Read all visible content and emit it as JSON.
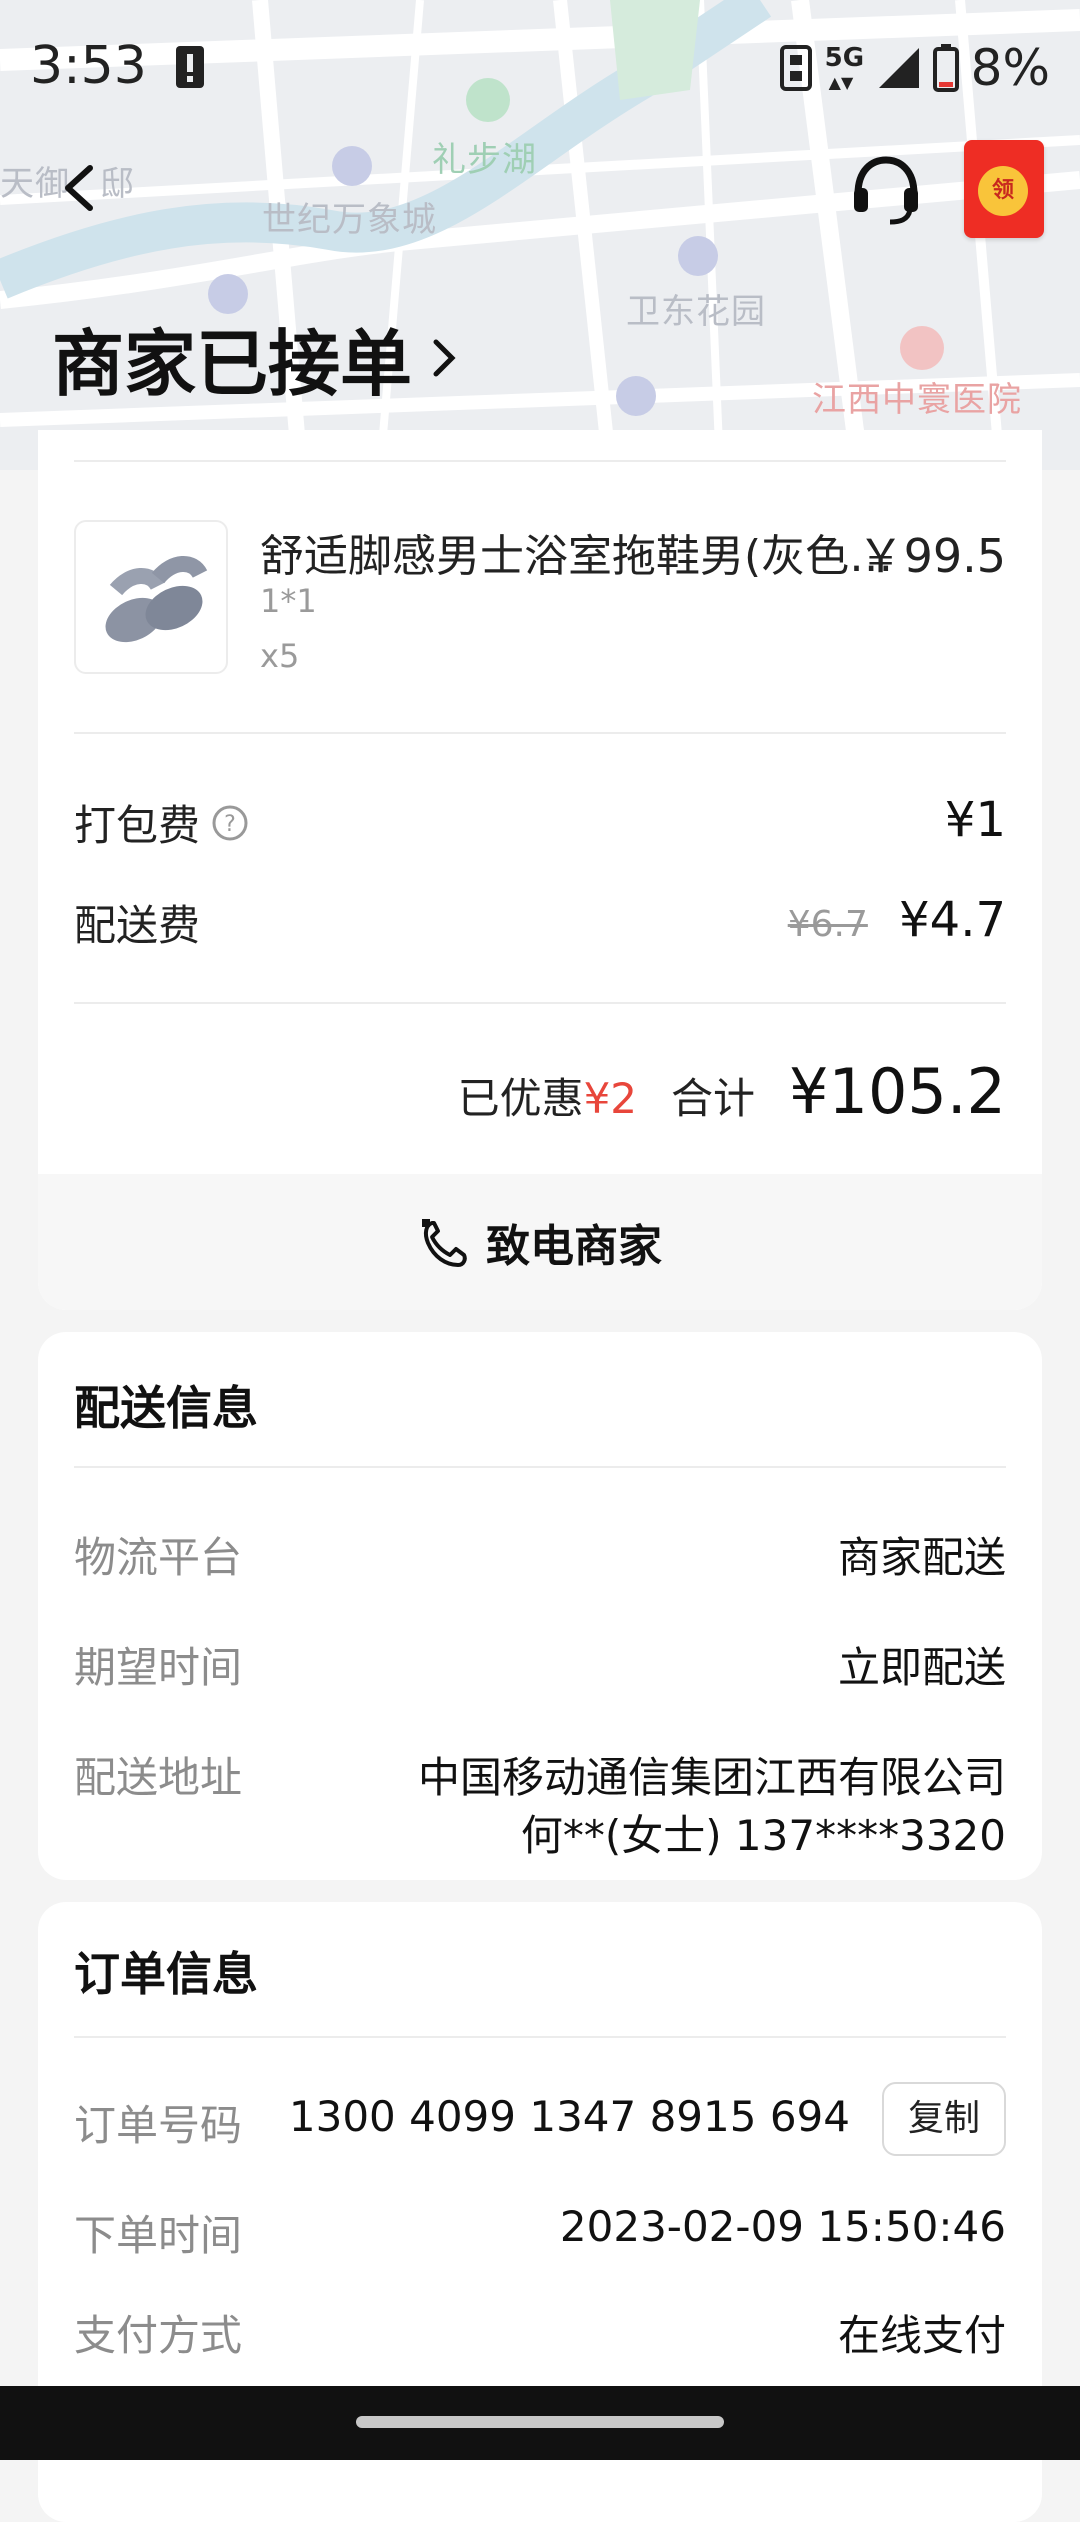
{
  "status_bar": {
    "time": "3:53",
    "network": "5G",
    "battery": "8%"
  },
  "map": {
    "labels": [
      "礼步湖",
      "天御",
      "邸",
      "世纪万象城",
      "卫东花园",
      "江西中寰医院"
    ]
  },
  "header": {
    "title": "商家已接单",
    "redpacket_label": "领"
  },
  "order": {
    "product": {
      "name": "舒适脚感男士浴室拖鞋男(灰色…",
      "price": "￥99.5",
      "spec": "1*1",
      "quantity": "x5"
    },
    "packing_fee": {
      "label": "打包费",
      "value": "¥1"
    },
    "delivery_fee": {
      "label": "配送费",
      "original": "¥6.7",
      "value": "¥4.7"
    },
    "discount": {
      "label": "已优惠",
      "value": "¥2"
    },
    "total": {
      "label": "合计",
      "value": "¥105.2"
    },
    "call_merchant_label": "致电商家"
  },
  "delivery_info": {
    "title": "配送信息",
    "platform": {
      "label": "物流平台",
      "value": "商家配送"
    },
    "expected_time": {
      "label": "期望时间",
      "value": "立即配送"
    },
    "address": {
      "label": "配送地址",
      "line1": "中国移动通信集团江西有限公司",
      "line2": "何**(女士) 137****3320"
    }
  },
  "order_info": {
    "title": "订单信息",
    "order_no": {
      "label": "订单号码",
      "value": "1300 4099 1347 8915 694",
      "copy_label": "复制"
    },
    "order_time": {
      "label": "下单时间",
      "value": "2023-02-09 15:50:46"
    },
    "payment": {
      "label": "支付方式",
      "value": "在线支付"
    }
  },
  "colors": {
    "accent_red": "#e8463b",
    "redpacket": "#ee2d24"
  }
}
